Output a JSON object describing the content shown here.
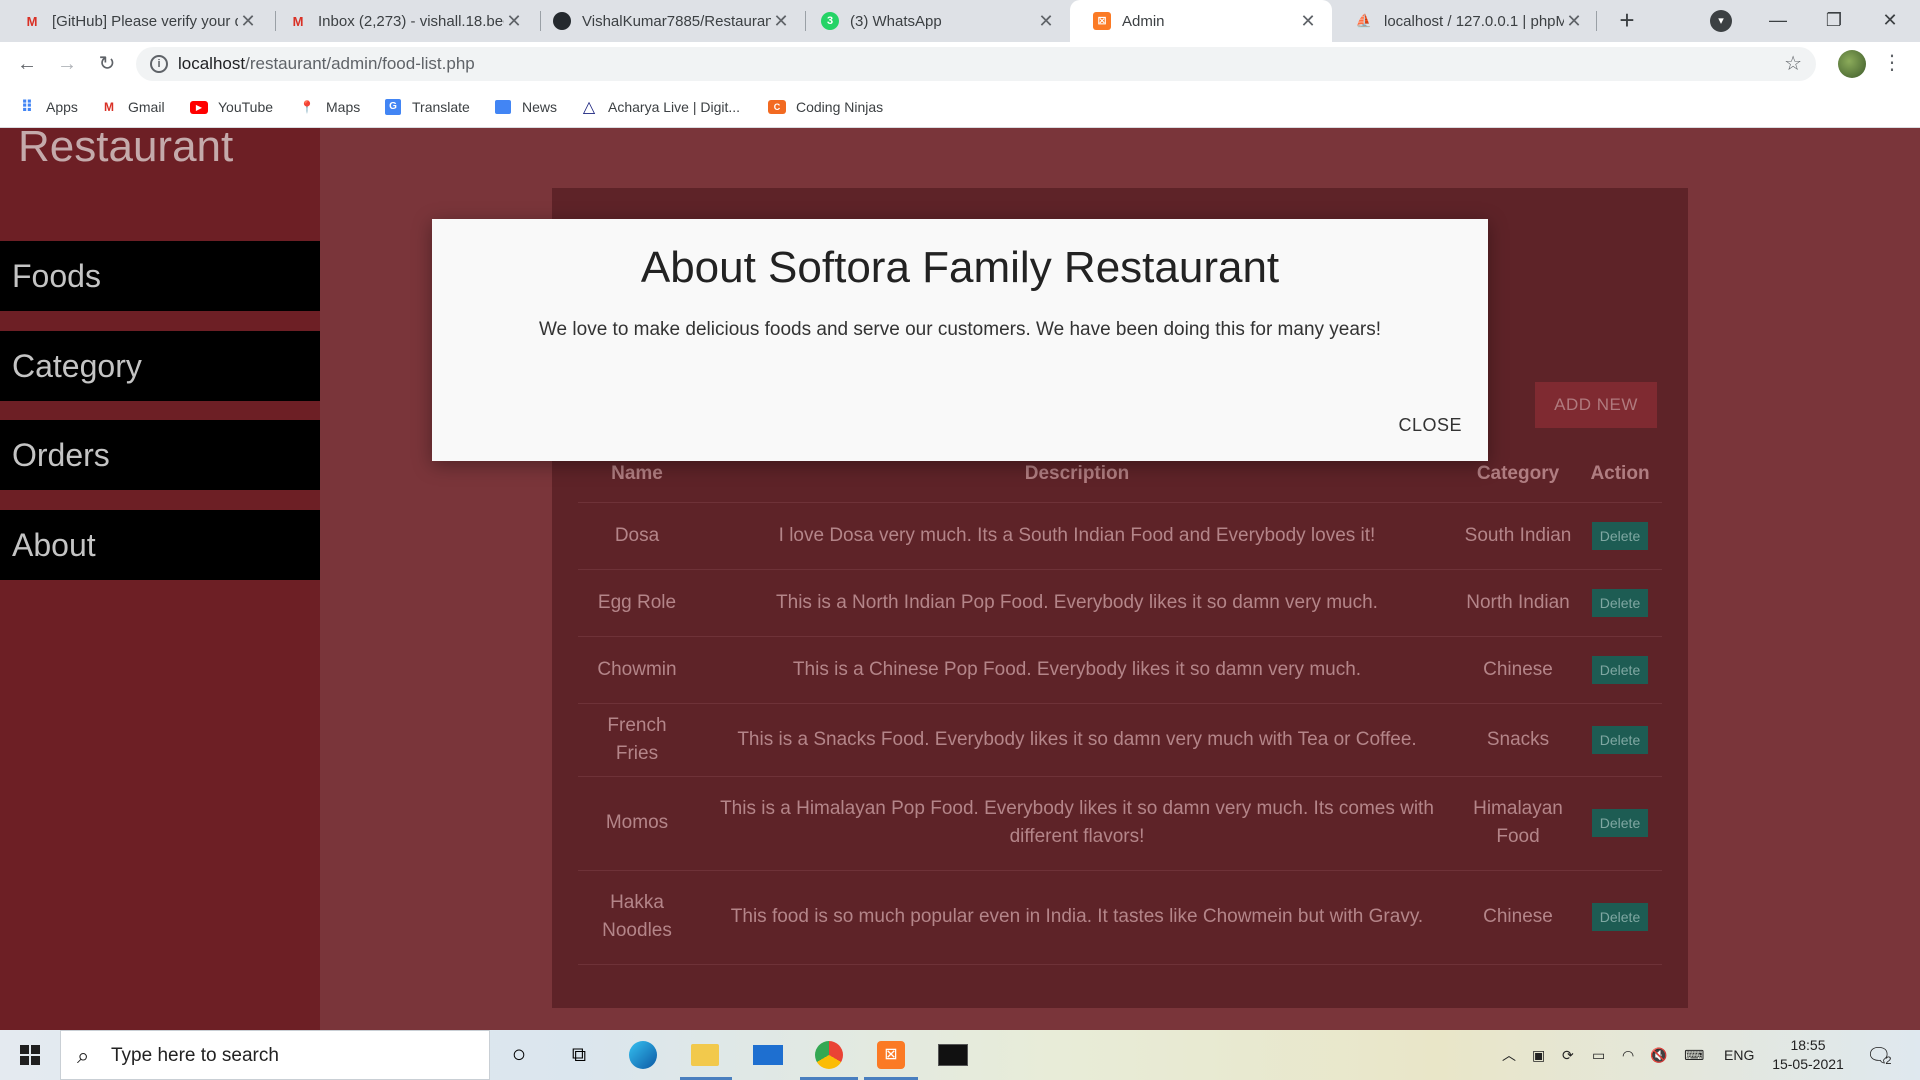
{
  "browser": {
    "tabs": [
      {
        "title": "[GitHub] Please verify your d",
        "favicon": "gmail-icon",
        "active": false
      },
      {
        "title": "Inbox (2,273) - vishall.18.bec",
        "favicon": "gmail-icon",
        "active": false
      },
      {
        "title": "VishalKumar7885/Restauran",
        "favicon": "github-icon",
        "active": false
      },
      {
        "title": "(3) WhatsApp",
        "favicon": "whatsapp-icon",
        "active": false
      },
      {
        "title": "Admin",
        "favicon": "xampp-icon",
        "active": true
      },
      {
        "title": "localhost / 127.0.0.1 | phpM",
        "favicon": "phpmyadmin-icon",
        "active": false
      }
    ],
    "url_host": "localhost",
    "url_path": "/restaurant/admin/food-list.php",
    "bookmarks": [
      "Apps",
      "Gmail",
      "YouTube",
      "Maps",
      "Translate",
      "News",
      "Acharya Live | Digit...",
      "Coding Ninjas"
    ]
  },
  "page": {
    "brand": "Restaurant",
    "nav": [
      "Foods",
      "Category",
      "Orders",
      "About"
    ],
    "add_new": "ADD NEW",
    "table": {
      "headers": [
        "Name",
        "Description",
        "Category",
        "Action"
      ],
      "delete_label": "Delete",
      "rows": [
        {
          "name": "Dosa",
          "description": "I love Dosa very much. Its a South Indian Food and Everybody loves it!",
          "category": "South Indian"
        },
        {
          "name": "Egg Role",
          "description": "This is a North Indian Pop Food. Everybody likes it so damn very much.",
          "category": "North Indian"
        },
        {
          "name": "Chowmin",
          "description": "This is a Chinese Pop Food. Everybody likes it so damn very much.",
          "category": "Chinese"
        },
        {
          "name": "French Fries",
          "description": "This is a Snacks Food. Everybody likes it so damn very much with Tea or Coffee.",
          "category": "Snacks"
        },
        {
          "name": "Momos",
          "description": "This is a Himalayan Pop Food. Everybody likes it so damn very much. Its comes with different flavors!",
          "category": "Himalayan Food"
        },
        {
          "name": "Hakka Noodles",
          "description": "This food is so much popular even in India. It tastes like Chowmein but with Gravy.",
          "category": "Chinese"
        }
      ]
    }
  },
  "modal": {
    "title": "About Softora Family Restaurant",
    "text": "We love to make delicious foods and serve our customers. We have been doing this for many years!",
    "close": "CLOSE"
  },
  "taskbar": {
    "search_placeholder": "Type here to search",
    "language": "ENG",
    "time": "18:55",
    "date": "15-05-2021",
    "notifications": "2"
  },
  "colors": {
    "page_bg": "#7a353a",
    "sidebar_bg": "#6d1f25",
    "panel_bg": "#5e2328",
    "delete_btn": "#1d5c53"
  }
}
